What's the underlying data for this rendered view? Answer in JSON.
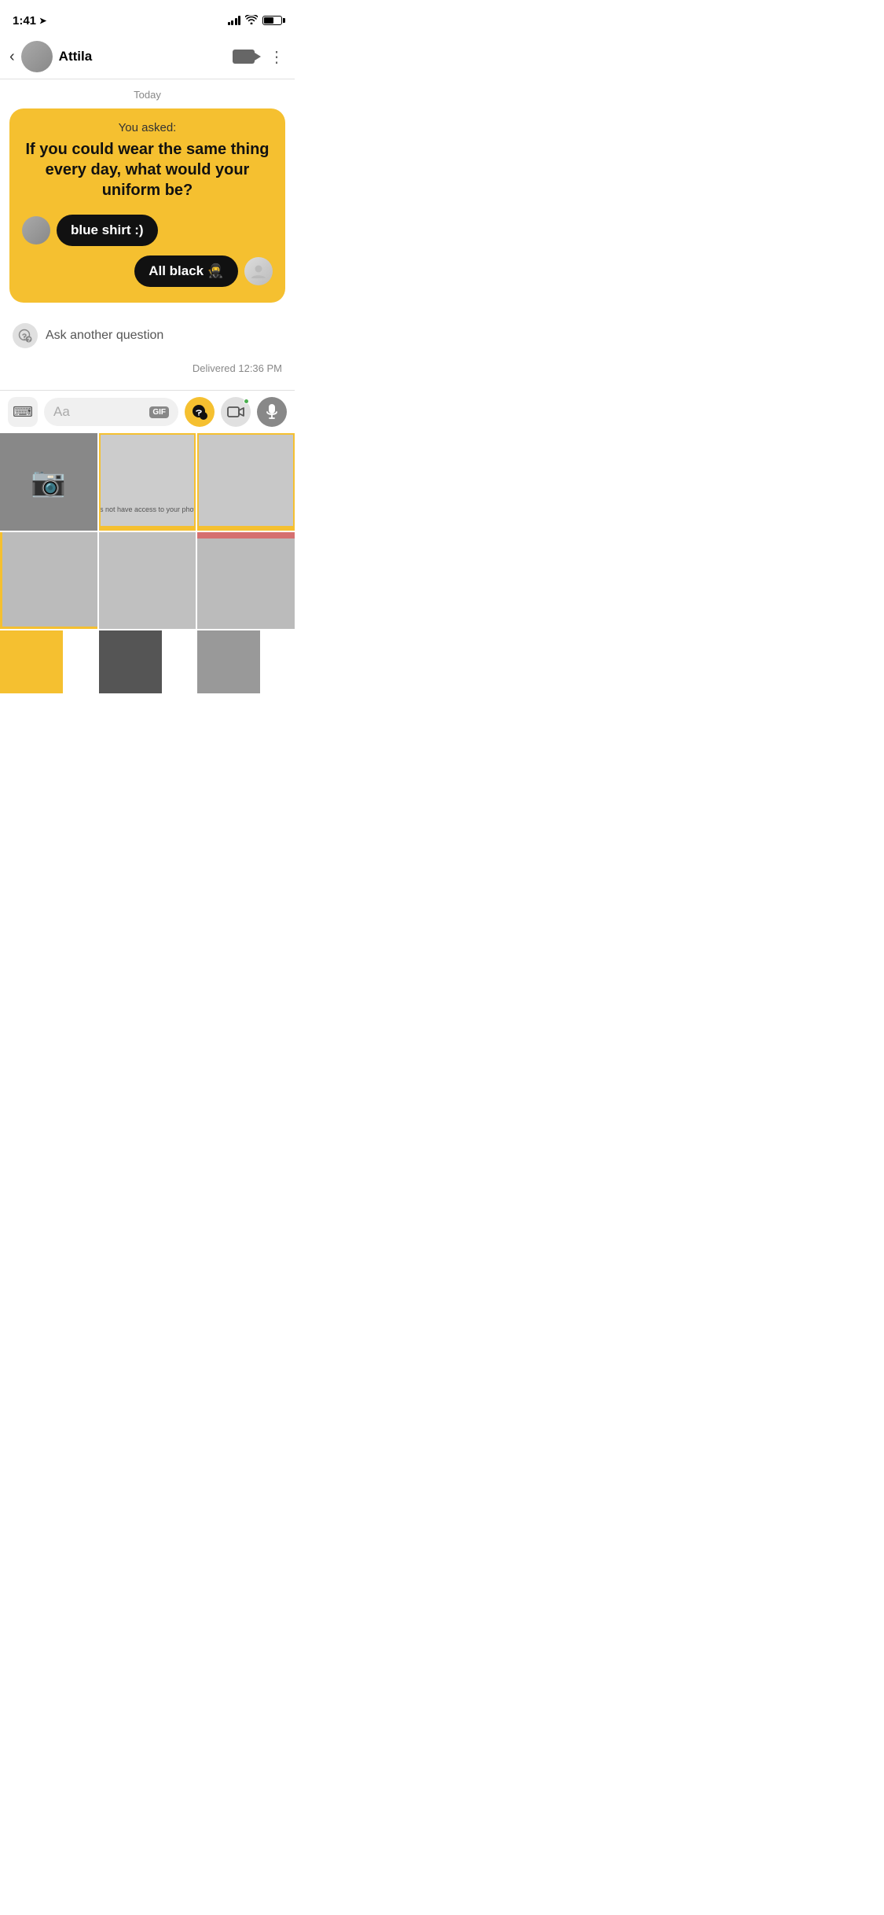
{
  "statusBar": {
    "time": "1:41",
    "locationIcon": "➤"
  },
  "header": {
    "backLabel": "‹",
    "userName": "Attila",
    "videoLabel": "video",
    "moreLabel": "⋮"
  },
  "chat": {
    "dateLabel": "Today",
    "questionCard": {
      "youAsked": "You asked:",
      "questionText": "If you could wear the same thing every day, what would your uniform be?",
      "messages": [
        {
          "sender": "them",
          "text": "blue shirt :)"
        },
        {
          "sender": "me",
          "text": "All black 🥷"
        }
      ]
    },
    "askAnother": "Ask another question",
    "deliveredText": "Delivered 12:36 PM"
  },
  "toolbar": {
    "inputPlaceholder": "Aa",
    "gifLabel": "GIF"
  },
  "mediaGrid": {
    "noAccessText": "This app does not have access to your photos or videos."
  }
}
